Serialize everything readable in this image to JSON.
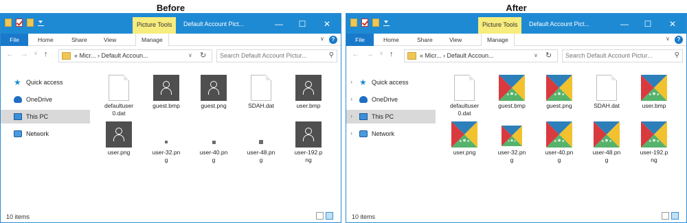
{
  "before_heading": "Before",
  "after_heading": "After",
  "window": {
    "picture_tools": "Picture Tools",
    "title": "Default Account Pict...",
    "minimize": "—",
    "maximize": "☐",
    "close": "✕"
  },
  "ribbon": {
    "tabs": [
      "File",
      "Home",
      "Share",
      "View",
      "Manage"
    ],
    "help": "?",
    "expand": "∨"
  },
  "nav": {
    "back": "←",
    "forward": "→",
    "recent": "∨",
    "up": "↑",
    "address_path": "«  Micr...  ›  Default Accoun...",
    "dropdown": "∨",
    "refresh": "↻",
    "search_placeholder": "Search Default Account Pictur...",
    "search_icon": "⚲"
  },
  "sidebar": {
    "items": [
      {
        "label": "Quick access",
        "icon": "star-icon"
      },
      {
        "label": "OneDrive",
        "icon": "cloud-icon"
      },
      {
        "label": "This PC",
        "icon": "computer-icon"
      },
      {
        "label": "Network",
        "icon": "network-icon"
      }
    ],
    "expand_glyph": "›"
  },
  "files": [
    {
      "name": "defaultuser0.dat",
      "line1": "defaultuser",
      "line2": "0.dat",
      "before": "doc",
      "after": "doc"
    },
    {
      "name": "guest.bmp",
      "line1": "guest.bmp",
      "line2": "",
      "before": "photo",
      "after": "colorful"
    },
    {
      "name": "guest.png",
      "line1": "guest.png",
      "line2": "",
      "before": "photo",
      "after": "colorful"
    },
    {
      "name": "SDAH.dat",
      "line1": "SDAH.dat",
      "line2": "",
      "before": "doc",
      "after": "doc"
    },
    {
      "name": "user.bmp",
      "line1": "user.bmp",
      "line2": "",
      "before": "photo",
      "after": "colorful"
    },
    {
      "name": "user.png",
      "line1": "user.png",
      "line2": "",
      "before": "photo",
      "after": "colorful"
    },
    {
      "name": "user-32.png",
      "line1": "user-32.pn",
      "line2": "g",
      "before": "tiny",
      "after": "colorful"
    },
    {
      "name": "user-40.png",
      "line1": "user-40.pn",
      "line2": "g",
      "before": "tiny",
      "after": "colorful"
    },
    {
      "name": "user-48.png",
      "line1": "user-48.pn",
      "line2": "g",
      "before": "tiny",
      "after": "colorful"
    },
    {
      "name": "user-192.png",
      "line1": "user-192.p",
      "line2": "ng",
      "before": "photo",
      "after": "colorful"
    }
  ],
  "status": {
    "items": "10 items"
  },
  "colors": {
    "titlebar": "#1e8ad3",
    "picture_tools_bg": "#f7ec7e",
    "file_tab": "#1979ca",
    "thumb_red": "#d83a3e",
    "thumb_blue": "#2c7fb8",
    "thumb_yellow": "#f2c12e",
    "thumb_green": "#56b36b"
  }
}
